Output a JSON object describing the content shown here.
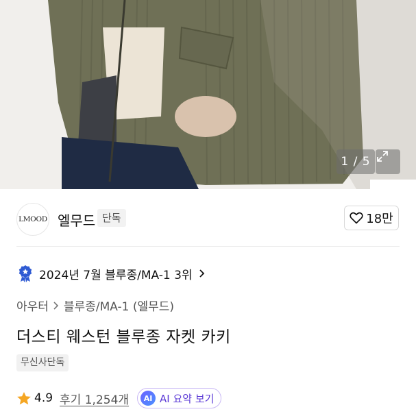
{
  "image": {
    "counter": "1 / 5",
    "description_icon": "expand-icon"
  },
  "brand": {
    "logo_text": "LMOOD",
    "name": "엘무드",
    "badge": "단독",
    "likes": "18만"
  },
  "ranking": {
    "text": "2024년 7월 블루종/MA-1 3위"
  },
  "breadcrumb": {
    "items": [
      "아우터",
      "블루종/MA-1 (엘무드)"
    ]
  },
  "product": {
    "title": "더스티 웨스턴 블루종 자켓 카키",
    "tag": "무신사단독"
  },
  "rating": {
    "score": "4.9",
    "reviews": "후기 1,254개",
    "ai_badge": "AI",
    "ai_label": "AI 요약 보기"
  },
  "colors": {
    "accent_purple": "#5b39d6",
    "star": "#f5a623",
    "rank_badge": "#2f5bd3"
  }
}
